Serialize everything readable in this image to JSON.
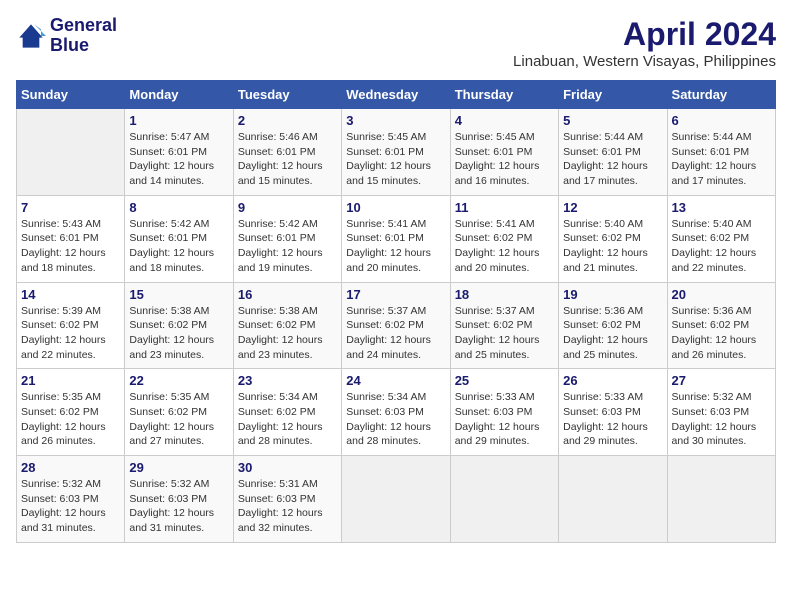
{
  "logo": {
    "line1": "General",
    "line2": "Blue"
  },
  "title": "April 2024",
  "subtitle": "Linabuan, Western Visayas, Philippines",
  "headers": [
    "Sunday",
    "Monday",
    "Tuesday",
    "Wednesday",
    "Thursday",
    "Friday",
    "Saturday"
  ],
  "weeks": [
    [
      {
        "day": "",
        "info": ""
      },
      {
        "day": "1",
        "info": "Sunrise: 5:47 AM\nSunset: 6:01 PM\nDaylight: 12 hours\nand 14 minutes."
      },
      {
        "day": "2",
        "info": "Sunrise: 5:46 AM\nSunset: 6:01 PM\nDaylight: 12 hours\nand 15 minutes."
      },
      {
        "day": "3",
        "info": "Sunrise: 5:45 AM\nSunset: 6:01 PM\nDaylight: 12 hours\nand 15 minutes."
      },
      {
        "day": "4",
        "info": "Sunrise: 5:45 AM\nSunset: 6:01 PM\nDaylight: 12 hours\nand 16 minutes."
      },
      {
        "day": "5",
        "info": "Sunrise: 5:44 AM\nSunset: 6:01 PM\nDaylight: 12 hours\nand 17 minutes."
      },
      {
        "day": "6",
        "info": "Sunrise: 5:44 AM\nSunset: 6:01 PM\nDaylight: 12 hours\nand 17 minutes."
      }
    ],
    [
      {
        "day": "7",
        "info": "Sunrise: 5:43 AM\nSunset: 6:01 PM\nDaylight: 12 hours\nand 18 minutes."
      },
      {
        "day": "8",
        "info": "Sunrise: 5:42 AM\nSunset: 6:01 PM\nDaylight: 12 hours\nand 18 minutes."
      },
      {
        "day": "9",
        "info": "Sunrise: 5:42 AM\nSunset: 6:01 PM\nDaylight: 12 hours\nand 19 minutes."
      },
      {
        "day": "10",
        "info": "Sunrise: 5:41 AM\nSunset: 6:01 PM\nDaylight: 12 hours\nand 20 minutes."
      },
      {
        "day": "11",
        "info": "Sunrise: 5:41 AM\nSunset: 6:02 PM\nDaylight: 12 hours\nand 20 minutes."
      },
      {
        "day": "12",
        "info": "Sunrise: 5:40 AM\nSunset: 6:02 PM\nDaylight: 12 hours\nand 21 minutes."
      },
      {
        "day": "13",
        "info": "Sunrise: 5:40 AM\nSunset: 6:02 PM\nDaylight: 12 hours\nand 22 minutes."
      }
    ],
    [
      {
        "day": "14",
        "info": "Sunrise: 5:39 AM\nSunset: 6:02 PM\nDaylight: 12 hours\nand 22 minutes."
      },
      {
        "day": "15",
        "info": "Sunrise: 5:38 AM\nSunset: 6:02 PM\nDaylight: 12 hours\nand 23 minutes."
      },
      {
        "day": "16",
        "info": "Sunrise: 5:38 AM\nSunset: 6:02 PM\nDaylight: 12 hours\nand 23 minutes."
      },
      {
        "day": "17",
        "info": "Sunrise: 5:37 AM\nSunset: 6:02 PM\nDaylight: 12 hours\nand 24 minutes."
      },
      {
        "day": "18",
        "info": "Sunrise: 5:37 AM\nSunset: 6:02 PM\nDaylight: 12 hours\nand 25 minutes."
      },
      {
        "day": "19",
        "info": "Sunrise: 5:36 AM\nSunset: 6:02 PM\nDaylight: 12 hours\nand 25 minutes."
      },
      {
        "day": "20",
        "info": "Sunrise: 5:36 AM\nSunset: 6:02 PM\nDaylight: 12 hours\nand 26 minutes."
      }
    ],
    [
      {
        "day": "21",
        "info": "Sunrise: 5:35 AM\nSunset: 6:02 PM\nDaylight: 12 hours\nand 26 minutes."
      },
      {
        "day": "22",
        "info": "Sunrise: 5:35 AM\nSunset: 6:02 PM\nDaylight: 12 hours\nand 27 minutes."
      },
      {
        "day": "23",
        "info": "Sunrise: 5:34 AM\nSunset: 6:02 PM\nDaylight: 12 hours\nand 28 minutes."
      },
      {
        "day": "24",
        "info": "Sunrise: 5:34 AM\nSunset: 6:03 PM\nDaylight: 12 hours\nand 28 minutes."
      },
      {
        "day": "25",
        "info": "Sunrise: 5:33 AM\nSunset: 6:03 PM\nDaylight: 12 hours\nand 29 minutes."
      },
      {
        "day": "26",
        "info": "Sunrise: 5:33 AM\nSunset: 6:03 PM\nDaylight: 12 hours\nand 29 minutes."
      },
      {
        "day": "27",
        "info": "Sunrise: 5:32 AM\nSunset: 6:03 PM\nDaylight: 12 hours\nand 30 minutes."
      }
    ],
    [
      {
        "day": "28",
        "info": "Sunrise: 5:32 AM\nSunset: 6:03 PM\nDaylight: 12 hours\nand 31 minutes."
      },
      {
        "day": "29",
        "info": "Sunrise: 5:32 AM\nSunset: 6:03 PM\nDaylight: 12 hours\nand 31 minutes."
      },
      {
        "day": "30",
        "info": "Sunrise: 5:31 AM\nSunset: 6:03 PM\nDaylight: 12 hours\nand 32 minutes."
      },
      {
        "day": "",
        "info": ""
      },
      {
        "day": "",
        "info": ""
      },
      {
        "day": "",
        "info": ""
      },
      {
        "day": "",
        "info": ""
      }
    ]
  ]
}
